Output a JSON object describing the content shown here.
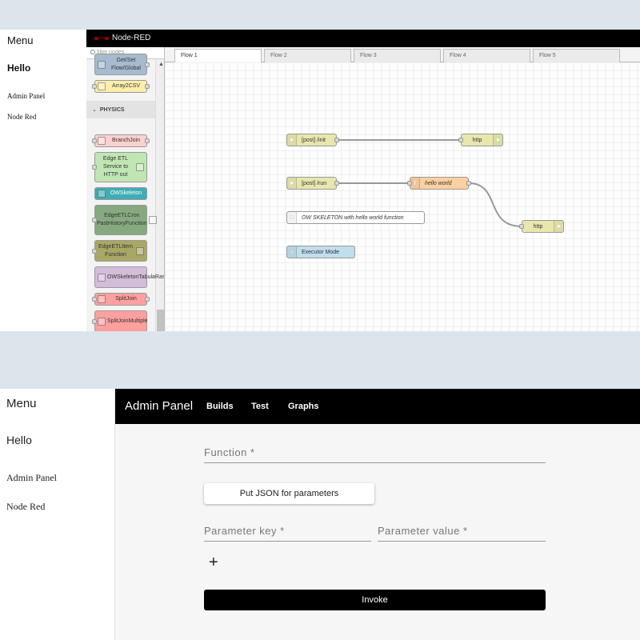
{
  "top": {
    "menu": {
      "title": "Menu",
      "hello": "Hello",
      "links": [
        "Admin Panel",
        "Node Red"
      ]
    },
    "nodered": {
      "title": "Node-RED",
      "filter_placeholder": "filter nodes",
      "palette": {
        "nodes_before": [
          {
            "label": "Get/Set Flow/Global",
            "color": "#a6bbcf"
          },
          {
            "label": "Array2CSV",
            "color": "#fdeeaa"
          }
        ],
        "category": "PHYSICS",
        "nodes": [
          {
            "label": "BranchJoin",
            "color": "#fdd0d0"
          },
          {
            "label": "Edge ETL Service to HTTP out",
            "color": "#c0e6b4"
          },
          {
            "label": "OWSkeleton",
            "color": "#3fadb5"
          },
          {
            "label": "EdgeETLCron PastHistoryFunction",
            "color": "#87a980"
          },
          {
            "label": "EdgeETLItem Function",
            "color": "#a8a865"
          },
          {
            "label": "OWSkeletonTabulaRasa",
            "color": "#d4bcdb"
          },
          {
            "label": "SplitJoin",
            "color": "#ff9f9f"
          },
          {
            "label": "SplitJoinMultiple",
            "color": "#ff9f9f"
          }
        ]
      },
      "tabs": [
        "Flow 1",
        "Flow 2",
        "Flow 3",
        "Flow 4",
        "Flow 5"
      ],
      "flow": {
        "http_in_1": "[post] /init",
        "http_resp_1": "http",
        "http_in_2": "[post] /run",
        "function": "hello world",
        "http_resp_2": "http",
        "comment": "OW SKELETON with hello world function",
        "executor": "Executor Mode"
      },
      "colors": {
        "http": "#e7e7ae",
        "function": "#fdd0a2",
        "comment": "#ffffff",
        "executor": "#c0deed"
      }
    }
  },
  "bottom": {
    "menu": {
      "title": "Menu",
      "hello": "Hello",
      "links": [
        "Admin Panel",
        "Node Red"
      ]
    },
    "admin": {
      "title": "Admin Panel",
      "nav": [
        "Builds",
        "Test",
        "Graphs"
      ],
      "function_label": "Function *",
      "json_button": "Put JSON for parameters",
      "param_key_label": "Parameter key *",
      "param_value_label": "Parameter value *",
      "add_label": "+",
      "invoke_label": "Invoke"
    }
  }
}
